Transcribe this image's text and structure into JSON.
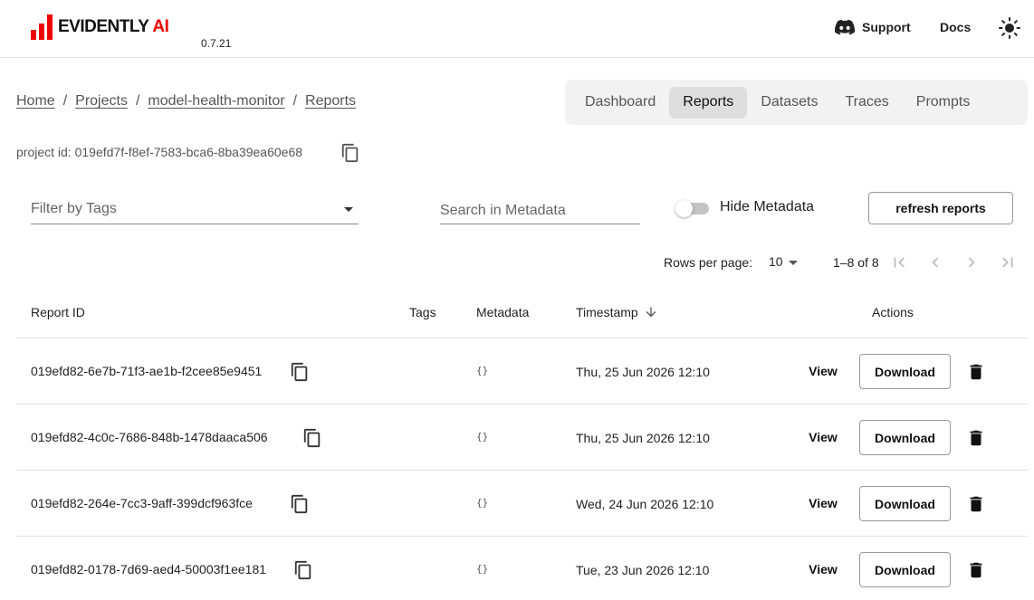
{
  "header": {
    "logo_text_main": "EVIDENTLY",
    "logo_text_ai": "AI",
    "version": "0.7.21",
    "support_label": "Support",
    "docs_label": "Docs",
    "brand_color": "#ed0400"
  },
  "breadcrumb": [
    "Home",
    "Projects",
    "model-health-monitor",
    "Reports"
  ],
  "tabs": [
    {
      "label": "Dashboard",
      "active": false
    },
    {
      "label": "Reports",
      "active": true
    },
    {
      "label": "Datasets",
      "active": false
    },
    {
      "label": "Traces",
      "active": false
    },
    {
      "label": "Prompts",
      "active": false
    }
  ],
  "project": {
    "id_text": "project id: 019efd7f-f8ef-7583-bca6-8ba39ea60e68"
  },
  "filters": {
    "tags_placeholder": "Filter by Tags",
    "search_placeholder": "Search in Metadata",
    "hide_metadata_label": "Hide Metadata",
    "hide_metadata_on": false,
    "refresh_label": "refresh reports"
  },
  "pagination": {
    "rows_per_page_label": "Rows per page:",
    "rows_per_page": "10",
    "range": "1–8 of 8"
  },
  "table": {
    "headers": {
      "report_id": "Report ID",
      "tags": "Tags",
      "metadata": "Metadata",
      "timestamp": "Timestamp",
      "actions": "Actions"
    },
    "view_label": "View",
    "download_label": "Download",
    "rows": [
      {
        "id": "019efd82-6e7b-71f3-ae1b-f2cee85e9451",
        "metadata": "{}",
        "timestamp": "Thu, 25 Jun 2026 12:10"
      },
      {
        "id": "019efd82-4c0c-7686-848b-1478daaca506",
        "metadata": "{}",
        "timestamp": "Thu, 25 Jun 2026 12:10"
      },
      {
        "id": "019efd82-264e-7cc3-9aff-399dcf963fce",
        "metadata": "{}",
        "timestamp": "Wed, 24 Jun 2026 12:10"
      },
      {
        "id": "019efd82-0178-7d69-aed4-50003f1ee181",
        "metadata": "{}",
        "timestamp": "Tue, 23 Jun 2026 12:10"
      }
    ]
  }
}
